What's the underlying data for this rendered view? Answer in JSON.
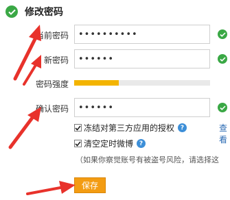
{
  "header": {
    "title": "修改密码"
  },
  "form": {
    "current_password": {
      "label": "当前密码",
      "value": "••••••••••"
    },
    "new_password": {
      "label": "新密码",
      "value": "••••••"
    },
    "strength": {
      "label": "密码强度",
      "level": 0.33,
      "fill_color": "#f3b400"
    },
    "confirm_password": {
      "label": "确认密码",
      "value": "••••••"
    }
  },
  "options": {
    "freeze_auth": {
      "label": "冻结对第三方应用的授权",
      "checked": true,
      "help": "?"
    },
    "clear_weibo": {
      "label": "清空定时微博",
      "checked": true,
      "help": "?"
    },
    "view_link": "查看"
  },
  "note": "（如果你察觉账号有被盗号风险，请选择这",
  "actions": {
    "save_label": "保存"
  },
  "colors": {
    "accent_green": "#3aa845",
    "button_orange": "#f39c12",
    "annotation_red": "#e8322b",
    "link_blue": "#2a6ab3"
  }
}
